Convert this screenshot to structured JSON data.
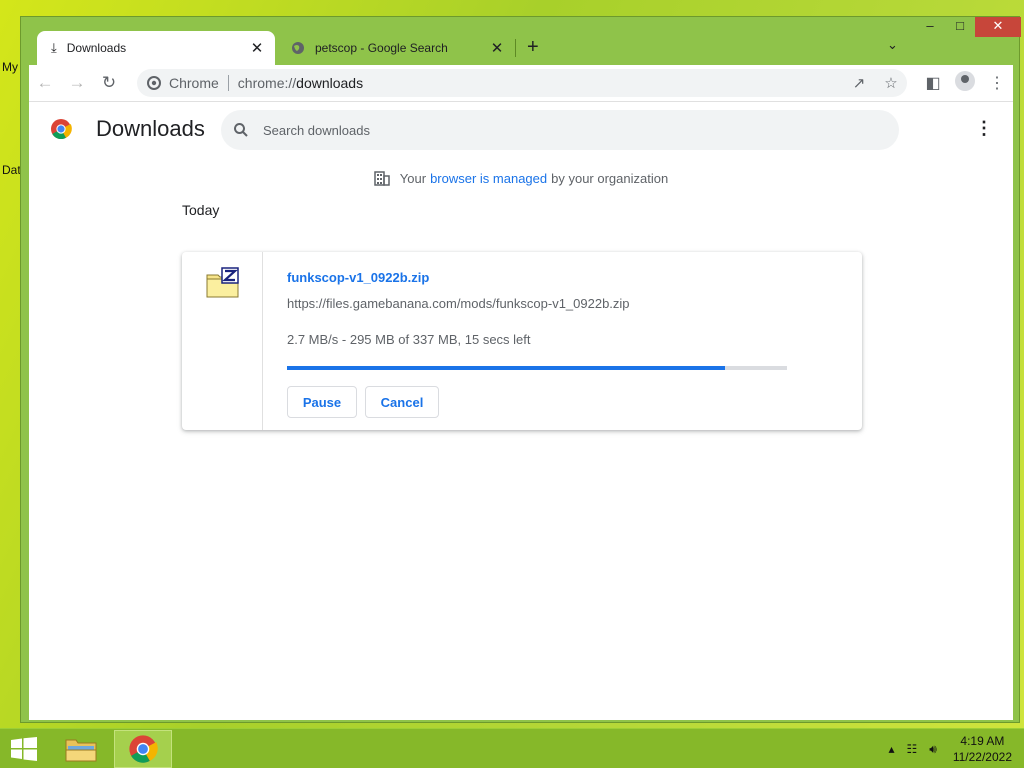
{
  "desktop": {
    "labels": [
      "My",
      "Dat"
    ]
  },
  "tabs": [
    {
      "title": "Downloads",
      "icon": "download-icon",
      "active": true
    },
    {
      "title": "petscop - Google Search",
      "icon": "globe-icon",
      "active": false
    }
  ],
  "omnibox": {
    "scheme_label": "Chrome",
    "url_prefix": "chrome://",
    "url_rest": "downloads"
  },
  "page": {
    "title": "Downloads",
    "search_placeholder": "Search downloads",
    "managed": {
      "prefix": "Your",
      "link": "browser is managed",
      "suffix": "by your organization"
    },
    "day_heading": "Today"
  },
  "download": {
    "file_name": "funkscop-v1_0922b.zip",
    "url": "https://files.gamebanana.com/mods/funkscop-v1_0922b.zip",
    "status": "2.7 MB/s - 295 MB of 337 MB, 15 secs left",
    "progress_fraction": 0.875,
    "pause_label": "Pause",
    "cancel_label": "Cancel"
  },
  "taskbar": {
    "time": "4:19 AM",
    "date": "11/22/2022"
  },
  "colors": {
    "accent": "#1a73e8",
    "window_frame": "#8fc34a",
    "close_button": "#c7463a"
  }
}
